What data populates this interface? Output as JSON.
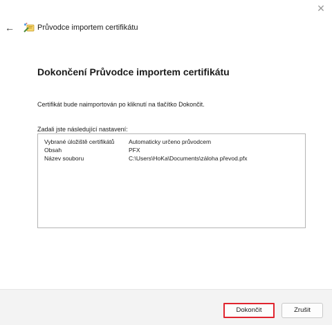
{
  "window": {
    "close_glyph": "✕",
    "back_glyph": "←",
    "title": "Průvodce importem certifikátu"
  },
  "main": {
    "heading": "Dokončení Průvodce importem certifikátu",
    "info": "Certifikát bude naimportován po kliknutí na tlačítko Dokončit.",
    "settings_label": "Zadali jste následující nastavení:",
    "settings": [
      {
        "key": "Vybrané úložiště certifikátů",
        "value": "Automaticky určeno průvodcem"
      },
      {
        "key": "Obsah",
        "value": "PFX"
      },
      {
        "key": "Název souboru",
        "value": "C:\\Users\\HoKa\\Documents\\záloha převod.pfx"
      }
    ]
  },
  "footer": {
    "finish_label": "Dokončit",
    "cancel_label": "Zrušit"
  },
  "colors": {
    "highlight": "#e0232d",
    "footer_bg": "#f3f3f3"
  }
}
